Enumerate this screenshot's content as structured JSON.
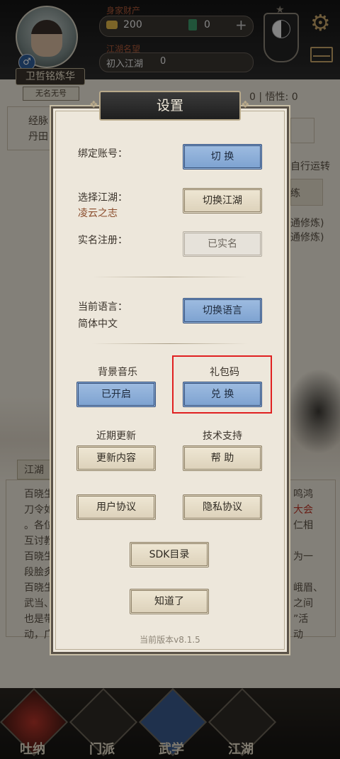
{
  "header": {
    "wealth_label": "身家财产",
    "gold": "200",
    "jade": "0",
    "fame_label": "江湖名望",
    "fame_value": "初入江湖",
    "fame_number": "0",
    "player_name": "卫哲铭炼华",
    "player_title": "无名无号",
    "gender_symbol": "♂"
  },
  "background": {
    "stats_text": "0 | 悟性: 0",
    "left_line1": "经脉",
    "left_line2": "丹田",
    "right_text1": "自行运转",
    "right_text2": "练",
    "right_text3": "通修炼)",
    "right_text4": "通修炼)",
    "news_tab": "江湖",
    "news_lines": [
      "百晓生",
      "刀令如",
      "。各位",
      "互讨教",
      "百晓生",
      "段脍炙",
      "百晓生",
      "武当、",
      "也是带",
      "动，广"
    ],
    "news_right": [
      "鸣鸿",
      "大会",
      "仁相",
      "为一",
      "峨眉、",
      "之间",
      "”活",
      "动"
    ]
  },
  "modal": {
    "title": "设置",
    "bind_account_label": "绑定账号：",
    "bind_account_button": "切 换",
    "select_world_label": "选择江湖：",
    "select_world_value": "凌云之志",
    "select_world_button": "切换江湖",
    "realname_label": "实名注册：",
    "realname_button": "已实名",
    "language_label": "当前语言：",
    "language_value": "简体中文",
    "language_button": "切换语言",
    "music_label": "背景音乐",
    "music_button": "已开启",
    "gift_label": "礼包码",
    "gift_button": "兑 换",
    "updates_label": "近期更新",
    "updates_button": "更新内容",
    "support_label": "技术支持",
    "support_button": "帮 助",
    "user_agreement_button": "用户协议",
    "privacy_button": "隐私协议",
    "sdk_button": "SDK目录",
    "ok_button": "知道了",
    "version": "当前版本v8.1.5"
  },
  "nav": {
    "tabs": [
      "吐纳",
      "门派",
      "武学",
      "江湖"
    ]
  },
  "colors": {
    "accent_blue": "#8fb0da",
    "highlight_red": "#e02020",
    "panel_bg": "#ede7db"
  }
}
